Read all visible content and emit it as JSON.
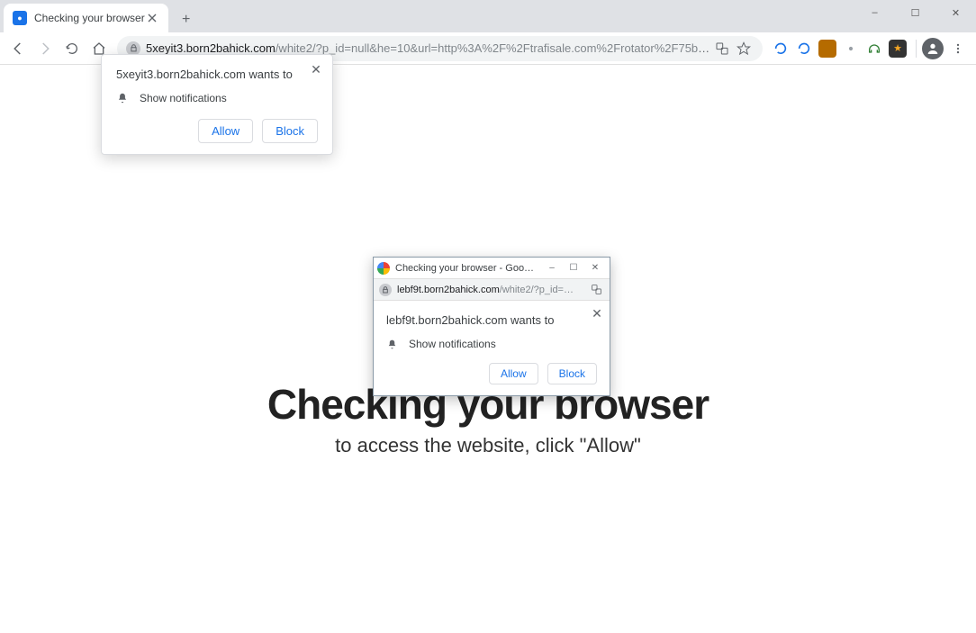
{
  "window_controls": {
    "minimize": "–",
    "maximize": "☐",
    "close": "✕"
  },
  "tab": {
    "title": "Checking your browser"
  },
  "toolbar": {
    "url_host": "5xeyit3.born2bahick.com",
    "url_path": "/white2/?p_id=null&he=10&url=http%3A%2F%2Ftrafisale.com%2Frotator%2F75bb7e4104%2F%7B%..."
  },
  "notification": {
    "title": "5xeyit3.born2bahick.com wants to",
    "perm_text": "Show notifications",
    "allow": "Allow",
    "block": "Block"
  },
  "page_content": {
    "heading": "Checking your browser",
    "sub": "to access the website, click \"Allow\""
  },
  "mini": {
    "title": "Checking your browser - Goo…",
    "url_host": "lebf9t.born2bahick.com",
    "url_path": "/white2/?p_id=…",
    "notif_title": "lebf9t.born2bahick.com wants to",
    "perm_text": "Show notifications",
    "allow": "Allow",
    "block": "Block"
  }
}
